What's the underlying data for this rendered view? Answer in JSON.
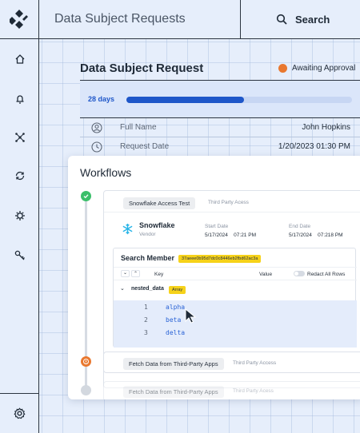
{
  "app": {
    "title": "Data Subject Requests"
  },
  "search": {
    "label": "Search"
  },
  "request": {
    "title": "Data Subject Request",
    "status": "Awaiting Approval",
    "days": "28 days",
    "progress": 0.52,
    "fields": [
      {
        "label": "Full Name",
        "value": "John Hopkins"
      },
      {
        "label": "Request Date",
        "value": "1/20/2023 01:30 PM"
      }
    ]
  },
  "workflows": {
    "title": "Workflows",
    "steps": [
      {
        "name": "Snowflake Access Test",
        "type": "Third Party Acess",
        "vendor": {
          "name": "Snowflake",
          "role": "Vendor"
        },
        "start_label": "Start Date",
        "start_date": "5/17/2024",
        "start_time": "07:21 PM",
        "end_label": "End Date",
        "end_date": "5/17/2024",
        "end_time": "07:218 PM",
        "search_member": {
          "title": "Search Member",
          "id": "37aeee0b95d7dc0c8446eb2fbd62ac3a",
          "col_key": "Key",
          "col_value": "Value",
          "redact_label": "Redact All Rows",
          "field_name": "nested_data",
          "field_type": "Array",
          "rows": [
            {
              "index": "1",
              "value": "alpha"
            },
            {
              "index": "2",
              "value": "beta"
            },
            {
              "index": "3",
              "value": "delta"
            }
          ]
        }
      },
      {
        "name": "Fetch Data from Third-Party Apps",
        "type": "Third Party Access"
      },
      {
        "name": "Fetch Data from Third-Party Apps",
        "type": "Third Party Acess"
      }
    ]
  },
  "colors": {
    "accent": "#1f57c9",
    "status_orange": "#e9782f",
    "success_green": "#3bbf6a",
    "tag_yellow": "#f6d21a"
  }
}
